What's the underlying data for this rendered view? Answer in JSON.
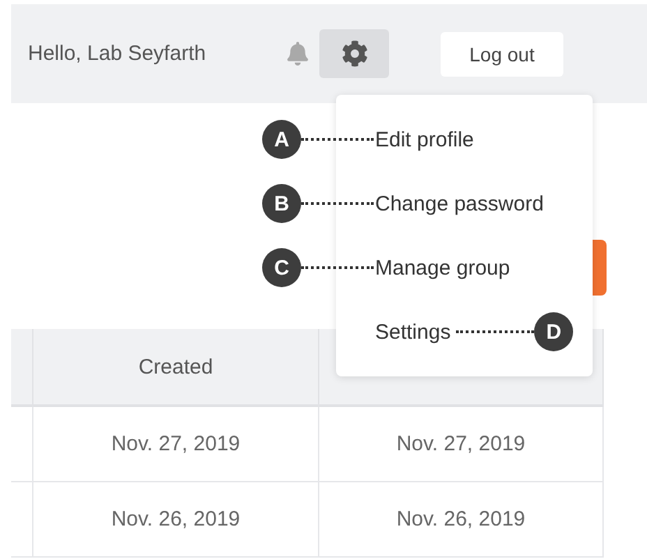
{
  "header": {
    "greeting": "Hello, Lab Seyfarth",
    "logout": "Log out",
    "settings_open": true
  },
  "menu": {
    "items": [
      {
        "label": "Edit profile",
        "callout": {
          "letter": "A",
          "kind": "left"
        }
      },
      {
        "label": "Change password",
        "callout": {
          "letter": "B",
          "kind": "left"
        }
      },
      {
        "label": "Manage group",
        "callout": {
          "letter": "C",
          "kind": "left"
        }
      },
      {
        "label": "Settings",
        "callout": {
          "letter": "D",
          "kind": "right"
        }
      }
    ]
  },
  "table": {
    "columns": [
      {
        "label": "Created"
      }
    ],
    "rows": [
      [
        "Nov. 27, 2019",
        "Nov. 27, 2019"
      ],
      [
        "Nov. 26, 2019",
        "Nov. 26, 2019"
      ]
    ]
  }
}
